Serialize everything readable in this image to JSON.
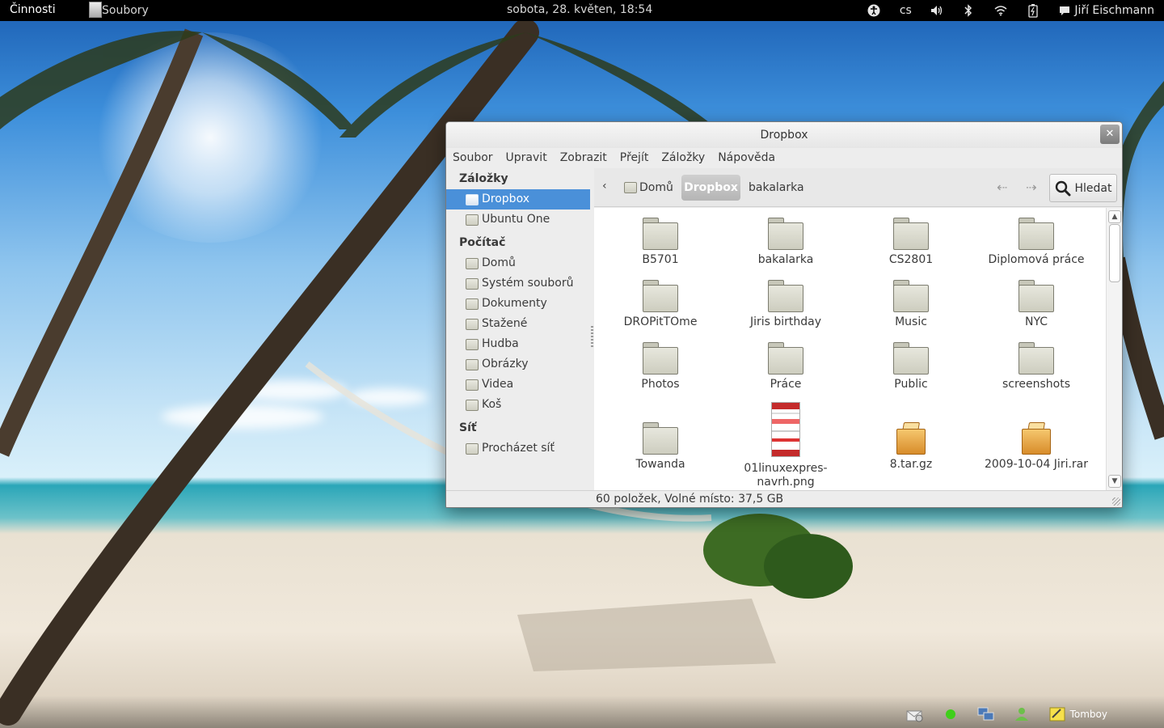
{
  "top_panel": {
    "activities": "Činnosti",
    "app_name": "Soubory",
    "clock": "sobota, 28. květen, 18:54",
    "language": "cs",
    "user": "Jiří Eischmann"
  },
  "window": {
    "title": "Dropbox",
    "menu": [
      "Soubor",
      "Upravit",
      "Zobrazit",
      "Přejít",
      "Záložky",
      "Nápověda"
    ]
  },
  "sidebar": {
    "sections": [
      {
        "heading": "Záložky",
        "items": [
          {
            "label": "Dropbox",
            "icon": "folder-icon",
            "selected": true
          },
          {
            "label": "Ubuntu One",
            "icon": "folder-icon"
          }
        ]
      },
      {
        "heading": "Počítač",
        "items": [
          {
            "label": "Domů",
            "icon": "home-folder-icon"
          },
          {
            "label": "Systém souborů",
            "icon": "drive-icon"
          },
          {
            "label": "Dokumenty",
            "icon": "documents-folder-icon"
          },
          {
            "label": "Stažené",
            "icon": "downloads-folder-icon"
          },
          {
            "label": "Hudba",
            "icon": "music-folder-icon"
          },
          {
            "label": "Obrázky",
            "icon": "pictures-folder-icon"
          },
          {
            "label": "Videa",
            "icon": "videos-folder-icon"
          },
          {
            "label": "Koš",
            "icon": "trash-icon"
          }
        ]
      },
      {
        "heading": "Síť",
        "items": [
          {
            "label": "Procházet síť",
            "icon": "network-icon"
          }
        ]
      }
    ]
  },
  "pathbar": {
    "crumbs": [
      "Domů",
      "Dropbox",
      "bakalarka"
    ],
    "search_label": "Hledat"
  },
  "files": [
    {
      "name": "B5701",
      "type": "folder"
    },
    {
      "name": "bakalarka",
      "type": "folder"
    },
    {
      "name": "CS2801",
      "type": "folder"
    },
    {
      "name": "Diplomová práce",
      "type": "folder"
    },
    {
      "name": "DROPitTOme",
      "type": "folder"
    },
    {
      "name": "Jiris birthday",
      "type": "folder"
    },
    {
      "name": "Music",
      "type": "folder"
    },
    {
      "name": "NYC",
      "type": "folder"
    },
    {
      "name": "Photos",
      "type": "folder"
    },
    {
      "name": "Práce",
      "type": "folder"
    },
    {
      "name": "Public",
      "type": "folder"
    },
    {
      "name": "screenshots",
      "type": "folder"
    },
    {
      "name": "Towanda",
      "type": "folder"
    },
    {
      "name": "01linuxexpres-navrh.png",
      "type": "image"
    },
    {
      "name": "8.tar.gz",
      "type": "archive"
    },
    {
      "name": "2009-10-04 Jiri.rar",
      "type": "archive"
    }
  ],
  "status": "60 položek, Volné místo: 37,5 GB",
  "bottom_tray": {
    "tomboy_label": "Tomboy"
  }
}
